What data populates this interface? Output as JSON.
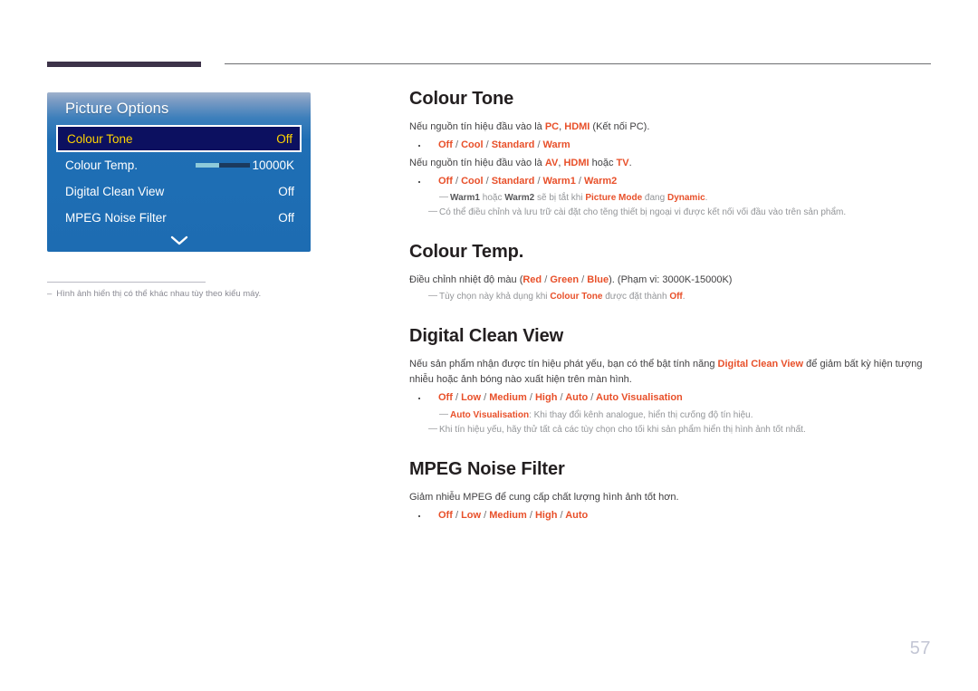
{
  "header": {
    "bar_color": "#3d3349",
    "line_color": "#6d6e71"
  },
  "osd": {
    "title": "Picture Options",
    "rows": [
      {
        "label": "Colour Tone",
        "value": "Off",
        "selected": true,
        "slider": false
      },
      {
        "label": "Colour Temp.",
        "value": "10000K",
        "selected": false,
        "slider": true
      },
      {
        "label": "Digital Clean View",
        "value": "Off",
        "selected": false,
        "slider": false
      },
      {
        "label": "MPEG Noise Filter",
        "value": "Off",
        "selected": false,
        "slider": false
      }
    ],
    "scroll_icon": "chevron-down-icon",
    "highlight_bg": "#0c1060",
    "highlight_text": "#ffd400",
    "panel_blue": "#1d6cb2"
  },
  "figure_note": {
    "dash": "–",
    "text": "Hình ảnh hiển thị có thể khác nhau tùy theo kiểu máy."
  },
  "sections": {
    "colour_tone": {
      "heading": "Colour Tone",
      "line1": {
        "pre": "Nếu nguồn tín hiệu đầu vào là ",
        "hl1": "PC",
        "mid": ", ",
        "hl2": "HDMI",
        "post": " (Kết nối PC)."
      },
      "options1": "Off / Cool / Standard / Warm",
      "line2": {
        "pre": "Nếu nguồn tín hiệu đầu vào là ",
        "hl1": "AV",
        "mid": ", ",
        "hl2": "HDMI",
        "mid2": " hoặc ",
        "hl3": "TV",
        "post": "."
      },
      "options2": "Off / Cool / Standard / Warm1 / Warm2",
      "note1": {
        "a": "Warm1",
        "b": " hoặc ",
        "c": "Warm2",
        "d": " sẽ bị tắt khi ",
        "e": "Picture Mode",
        "f": " đang ",
        "g": "Dynamic",
        "h": "."
      },
      "note2": "Có thể điều chỉnh và lưu trữ cài đặt cho tẽng thiết bị ngoại vi được kết nối vối đầu vào trên sản phẩm."
    },
    "colour_temp": {
      "heading": "Colour Temp.",
      "line1": {
        "pre": "Điều chỉnh nhiệt độ màu (",
        "red": "Red",
        "s1": " / ",
        "green": "Green",
        "s2": " / ",
        "blue": "Blue",
        "post": "). (Phạm vi: 3000K-15000K)"
      },
      "note1": {
        "pre": "Tùy chọn này khả dụng khi ",
        "a": "Colour Tone",
        "mid": " được đặt thành ",
        "b": "Off",
        "post": "."
      }
    },
    "digital_clean_view": {
      "heading": "Digital Clean View",
      "line1": {
        "pre": "Nếu sản phẩm nhận được tín hiệu phát yếu, bạn có thể bật tính năng ",
        "hl": "Digital Clean View",
        "post": " để giảm bất kỳ hiện tượng nhiễu hoặc ảnh bóng nào xuất hiện trên màn hình."
      },
      "options": "Off / Low / Medium / High / Auto / Auto Visualisation",
      "note1": {
        "a": "Auto Visualisation",
        "post": ": Khi thay đổi kênh analogue, hiển thị cưống độ tín hiệu."
      },
      "note2": "Khi tín hiệu yếu, hãy thử tất cả các tùy chọn cho tối khi sản phẩm hiển thị hình ảnh tốt nhất."
    },
    "mpeg_noise_filter": {
      "heading": "MPEG Noise Filter",
      "line1": "Giảm nhiễu MPEG để cung cấp chất lượng hình ảnh tốt hơn.",
      "options": "Off / Low / Medium / High / Auto"
    }
  },
  "page_number": "57",
  "accents": {
    "orange": "#e8502a",
    "gray_note": "#939598",
    "body": "#414042",
    "heading": "#231f20"
  }
}
